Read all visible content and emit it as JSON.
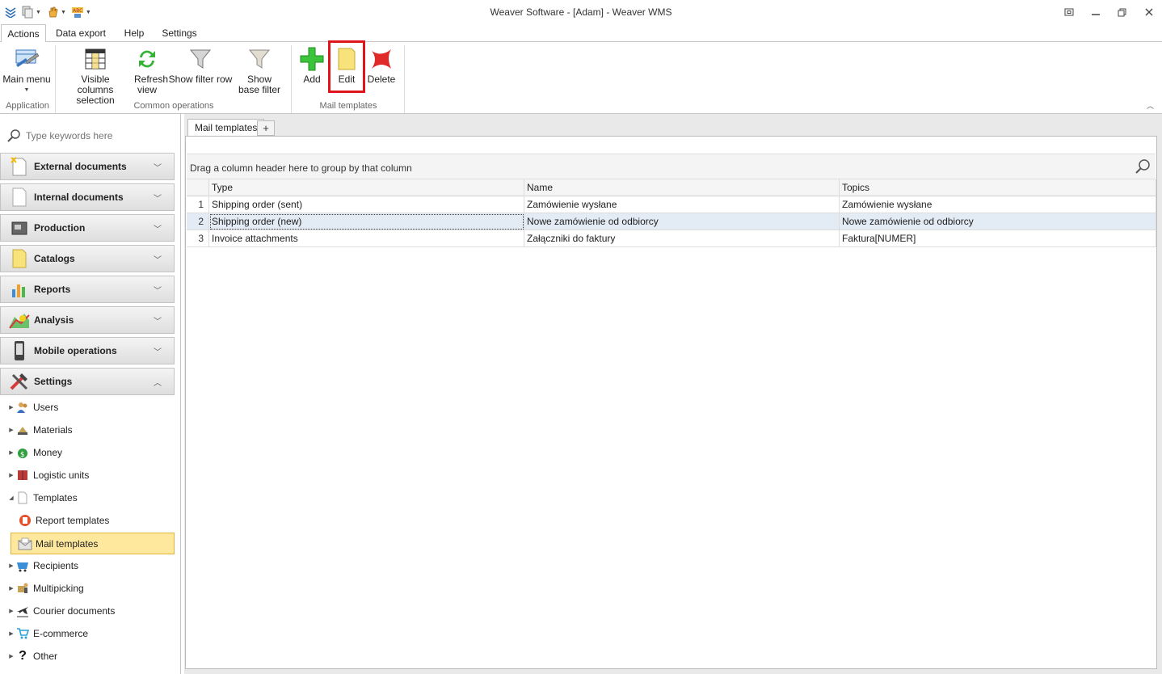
{
  "window": {
    "title": "Weaver Software - [Adam] - Weaver WMS"
  },
  "ribbon_tabs": [
    "Actions",
    "Data export",
    "Help",
    "Settings"
  ],
  "ribbon": {
    "main_menu": "Main menu",
    "visible_columns": "Visible columns selection",
    "refresh_view": "Refresh view",
    "show_filter_row": "Show filter row",
    "show_base_filter": "Show base filter",
    "add": "Add",
    "edit": "Edit",
    "delete": "Delete",
    "group_application": "Application",
    "group_common": "Common operations",
    "group_mail": "Mail templates"
  },
  "sidebar": {
    "search_placeholder": "Type keywords here",
    "groups": [
      "External documents",
      "Internal documents",
      "Production",
      "Catalogs",
      "Reports",
      "Analysis",
      "Mobile operations",
      "Settings"
    ],
    "tree": [
      "Users",
      "Materials",
      "Money",
      "Logistic units",
      "Templates",
      "Report templates",
      "Mail templates",
      "Recipients",
      "Multipicking",
      "Courier documents",
      "E-commerce",
      "Other"
    ]
  },
  "main": {
    "tab_label": "Mail templates",
    "add_tab": "+",
    "group_hint": "Drag a column header here to group by that column",
    "columns": [
      "Type",
      "Name",
      "Topics"
    ],
    "rows": [
      {
        "n": "1",
        "type": "Shipping order (sent)",
        "name": "Zamówienie wysłane",
        "topics": "Zamówienie wysłane"
      },
      {
        "n": "2",
        "type": "Shipping order (new)",
        "name": "Nowe zamówienie od odbiorcy",
        "topics": "Nowe zamówienie od odbiorcy"
      },
      {
        "n": "3",
        "type": "Invoice attachments",
        "name": "Załączniki do faktury",
        "topics": "Faktura[NUMER]"
      }
    ]
  },
  "colors": {
    "accent": "#2f6fb5",
    "highlight_border": "#e0141b",
    "selected_bg": "#fde89e"
  }
}
